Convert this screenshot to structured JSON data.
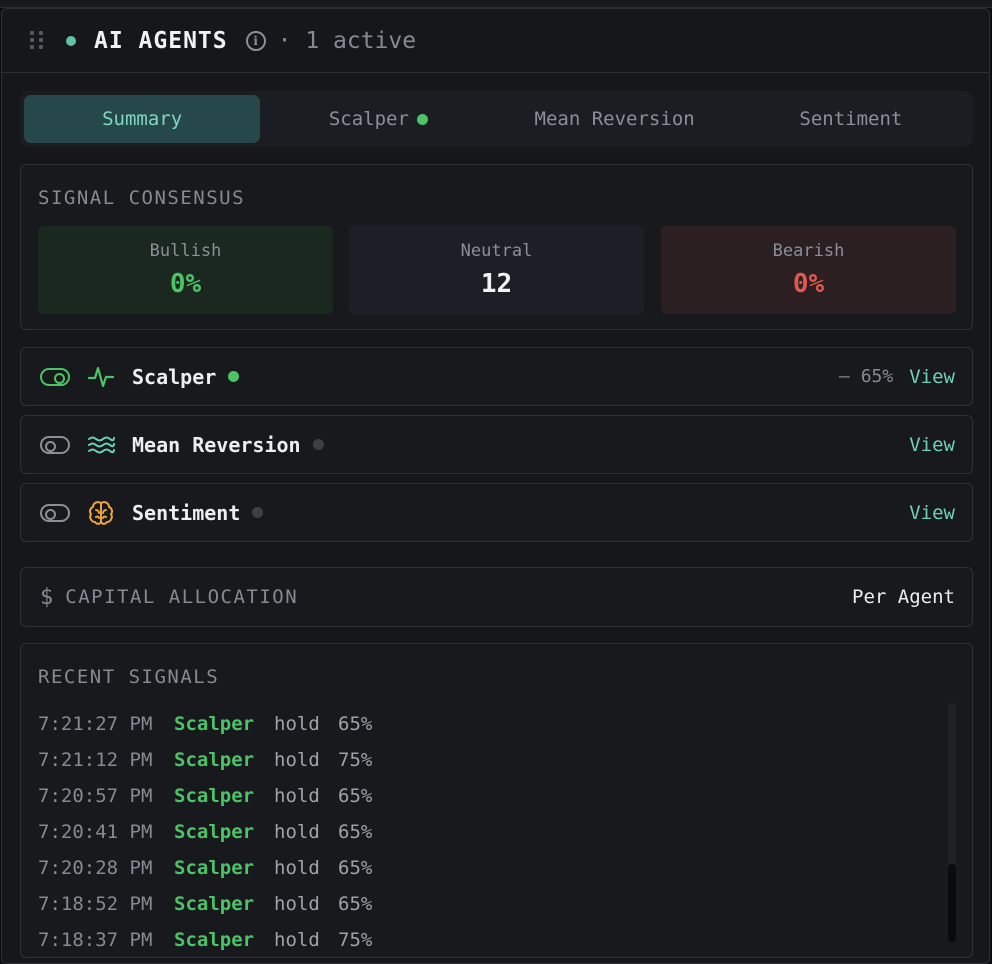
{
  "header": {
    "title": "AI AGENTS",
    "active_text": "· 1 active"
  },
  "tabs": [
    {
      "label": "Summary",
      "active": true
    },
    {
      "label": "Scalper",
      "active": false
    },
    {
      "label": "Mean Reversion",
      "active": false
    },
    {
      "label": "Sentiment",
      "active": false
    }
  ],
  "consensus": {
    "label": "SIGNAL CONSENSUS",
    "bullish": {
      "label": "Bullish",
      "value": "0%"
    },
    "neutral": {
      "label": "Neutral",
      "value": "12"
    },
    "bearish": {
      "label": "Bearish",
      "value": "0%"
    }
  },
  "agents": [
    {
      "name": "Scalper",
      "enabled": true,
      "active": true,
      "meta": "— 65%",
      "view": "View",
      "icon": "pulse-icon"
    },
    {
      "name": "Mean Reversion",
      "enabled": false,
      "active": false,
      "meta": "",
      "view": "View",
      "icon": "waves-icon"
    },
    {
      "name": "Sentiment",
      "enabled": false,
      "active": false,
      "meta": "",
      "view": "View",
      "icon": "brain-icon"
    }
  ],
  "capital": {
    "label": "CAPITAL ALLOCATION",
    "value": "Per Agent"
  },
  "signals": {
    "label": "RECENT SIGNALS",
    "rows": [
      {
        "time": "7:21:27 PM",
        "agent": "Scalper",
        "action": "hold",
        "confidence": "65%"
      },
      {
        "time": "7:21:12 PM",
        "agent": "Scalper",
        "action": "hold",
        "confidence": "75%"
      },
      {
        "time": "7:20:57 PM",
        "agent": "Scalper",
        "action": "hold",
        "confidence": "65%"
      },
      {
        "time": "7:20:41 PM",
        "agent": "Scalper",
        "action": "hold",
        "confidence": "65%"
      },
      {
        "time": "7:20:28 PM",
        "agent": "Scalper",
        "action": "hold",
        "confidence": "65%"
      },
      {
        "time": "7:18:52 PM",
        "agent": "Scalper",
        "action": "hold",
        "confidence": "65%"
      },
      {
        "time": "7:18:37 PM",
        "agent": "Scalper",
        "action": "hold",
        "confidence": "75%"
      }
    ]
  },
  "colors": {
    "accent": "#6fd0bb",
    "bullish": "#4cc466",
    "bearish": "#e0574f",
    "active_tab_bg": "#27484a",
    "waves_icon": "#6fd0bb",
    "brain_icon": "#f0a43c"
  }
}
